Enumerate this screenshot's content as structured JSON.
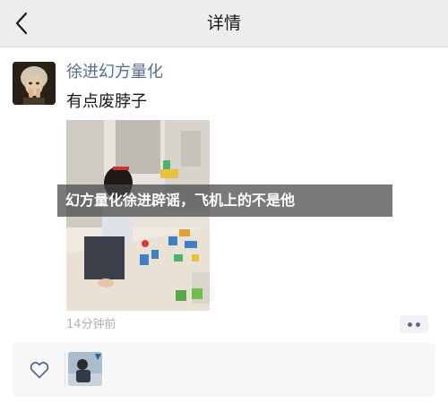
{
  "navbar": {
    "title": "详情",
    "back_icon": "chevron-left-icon"
  },
  "post": {
    "author": "徐进幻方量化",
    "text": "有点废脖子",
    "time": "14分钟前",
    "photo_description_icon": "photo-child-playing-blocks",
    "more_icon": "more-dots-icon"
  },
  "likes": {
    "icon": "heart-outline-icon"
  },
  "banner": {
    "text": "幻方量化徐进辟谣，飞机上的不是他"
  },
  "colors": {
    "link": "#576b95",
    "time": "#b2b2b2",
    "background": "#ededed",
    "card": "#ffffff"
  }
}
